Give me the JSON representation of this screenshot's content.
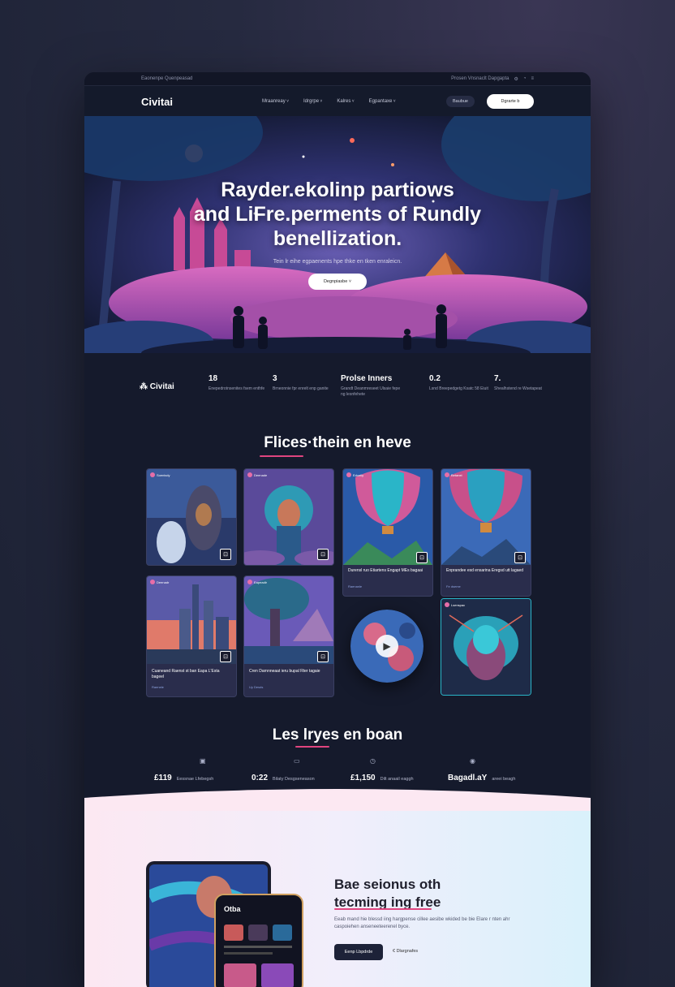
{
  "topstrip": {
    "left": "Eaonenpe Quenpeasad",
    "right": "Prosen Vnsnaclt Dapgapta",
    "icons": [
      "settings-icon",
      "bell-icon",
      "menu-icon"
    ]
  },
  "nav": {
    "logo": "Civitai",
    "menu": [
      "Mraanreay",
      "Idrgrpe",
      "Kalres",
      "Egpantaxe"
    ],
    "ghost_button": "Baubue",
    "cta_button": "Dgrarte b"
  },
  "hero": {
    "title_line1": "Rayder.ekolinp partiows",
    "title_line2": "and LiFre.perments of Rundly",
    "title_line3": "benellization.",
    "subtitle": "Tein lr eihe egpaenents hpe thke en tken enraleicn.",
    "cta": "Degnpiasbe ˅"
  },
  "stats": {
    "logo": "Civitai",
    "items": [
      {
        "value": "18",
        "label": "Enepedrotnsenites fsem enthfe"
      },
      {
        "value": "3",
        "label": "Brneonnie fpr enrelt enp ganite"
      },
      {
        "value": "Prolse Inners",
        "label": "Grandt Deanmreseet Ulsaie fepe ng lesnfehete"
      },
      {
        "value": "0.2",
        "label": "Lsnd Breepedgetg Ksatc 58 Eiuit"
      },
      {
        "value": "7.",
        "label": "Shealhstend re Wsetapeat"
      }
    ]
  },
  "featured": {
    "title": "Flices·thein en heve",
    "cards": [
      {
        "tag": "Soenisdy",
        "caption": "",
        "meta": ""
      },
      {
        "tag": "Deenade",
        "caption": "",
        "meta": ""
      },
      {
        "tag": "Edoelly",
        "caption": "Durensl ruo Etiartens Engapt MEs bagaai",
        "meta": "Raenanle"
      },
      {
        "tag": "Betanei",
        "caption": "Enprandee esd ensarina Eregsd utt lagaed",
        "meta": "Fe dseme"
      },
      {
        "tag": "Deenadr",
        "caption": "Cuaneand Raenst st ban Eapa L'Esta bageel",
        "meta": "Raenele"
      },
      {
        "tag": "Eapeadir",
        "caption": "Cren Darnnneaat ieru bupal Rter tagaie",
        "meta": "Uy Desds"
      },
      {
        "tag": "Lsenspac",
        "caption": "",
        "meta": ""
      }
    ],
    "play_label": "play"
  },
  "metrics_section": {
    "title": "Les lryes en boan",
    "items": [
      {
        "icon": "image-icon",
        "value": "£119",
        "label": "Eessnae Lfebegsh"
      },
      {
        "icon": "card-icon",
        "value": "0:22",
        "label": "Bilaty Desgseneason"
      },
      {
        "icon": "clock-icon",
        "value": "£1,150",
        "label": "Dilt anaail eaggh"
      },
      {
        "icon": "globe-icon",
        "value": "Bagadl.aY",
        "label": "areei beagh"
      }
    ]
  },
  "app_section": {
    "title_line1": "Bae seionus oth",
    "title_line2": "tecming ing free",
    "paragraph": "Eeab mand hie blessd iing hargpense cillee aesibe wkided be bie Elare r nten ahr caspoiehen anseneeteerenel byce.",
    "button": "Eenp Lbpdrde",
    "link": "€ Dlargnafes",
    "phone_title": "Otba"
  },
  "colors": {
    "accent": "#e0457f",
    "bg": "#151a2c"
  }
}
